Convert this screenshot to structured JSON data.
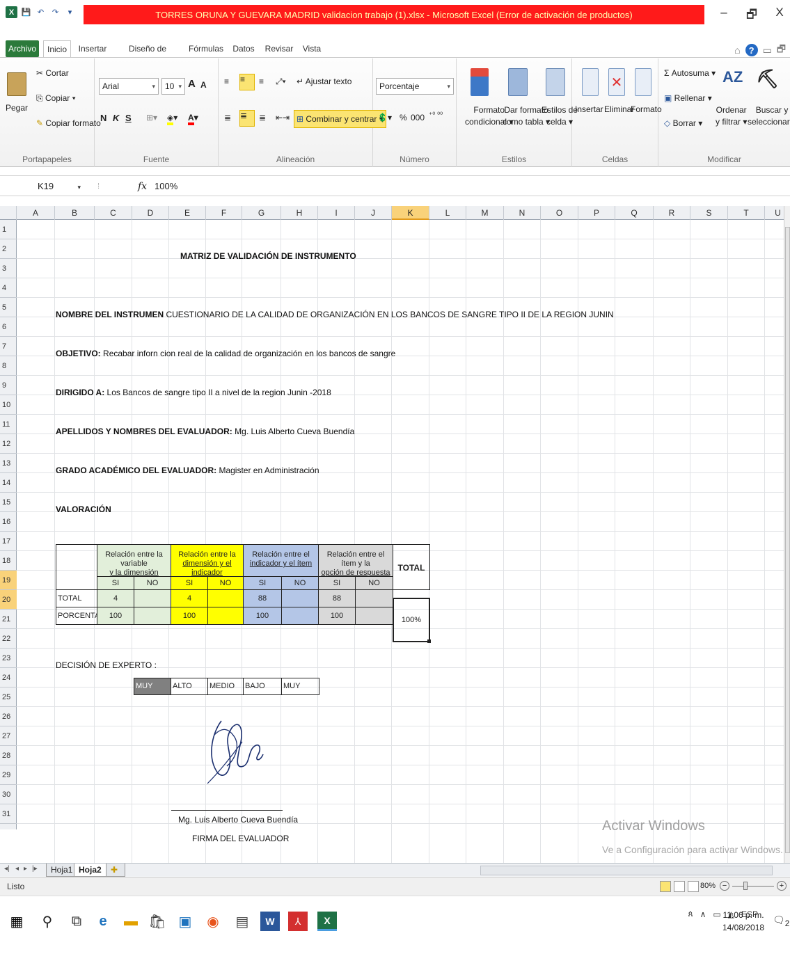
{
  "window": {
    "title": "TORRES ORUNA Y GUEVARA MADRID validacion trabajo (1).xlsx - Microsoft Excel (Error de activación de productos)",
    "minimize": "–",
    "restore": "🗗",
    "close": "X"
  },
  "tabs": [
    "Archivo",
    "Inicio",
    "Insertar",
    "Diseño de página",
    "Fórmulas",
    "Datos",
    "Revisar",
    "Vista"
  ],
  "ribbon": {
    "clipboard": {
      "paste": "Pegar",
      "cut": "Cortar",
      "copy": "Copiar ▾",
      "format_painter": "Copiar formato",
      "label": "Portapapeles"
    },
    "font": {
      "name": "Arial",
      "size": "10",
      "bold": "N",
      "italic": "K",
      "underline": "S",
      "grow": "A",
      "shrink": "A",
      "label": "Fuente"
    },
    "alignment": {
      "wrap": "Ajustar texto",
      "merge": "Combinar y centrar",
      "label": "Alineación"
    },
    "number": {
      "format": "Porcentaje",
      "percent": "%",
      "thousands": "000",
      "label": "Número"
    },
    "styles": {
      "conditional_1": "Formato",
      "conditional_2": "condicional ▾",
      "table_1": "Dar formato",
      "table_2": "como tabla ▾",
      "cell_1": "Estilos de",
      "cell_2": "celda ▾",
      "label": "Estilos"
    },
    "cells": {
      "insert": "Insertar",
      "delete": "Eliminar",
      "format": "Formato",
      "label": "Celdas"
    },
    "editing": {
      "autosum": "Σ Autosuma ▾",
      "fill": "Rellenar ▾",
      "clear": "Borrar ▾",
      "sort_1": "Ordenar",
      "sort_2": "y filtrar ▾",
      "find_1": "Buscar y",
      "find_2": "seleccionar ▾",
      "label": "Modificar"
    }
  },
  "formula_bar": {
    "name_box": "K19",
    "fx": "fx",
    "value": "100%"
  },
  "columns": [
    "A",
    "B",
    "C",
    "D",
    "E",
    "F",
    "G",
    "H",
    "I",
    "J",
    "K",
    "L",
    "M",
    "N",
    "O",
    "P",
    "Q",
    "R",
    "S",
    "T",
    "U"
  ],
  "selected_column": "K",
  "selected_rows": [
    "19",
    "20"
  ],
  "sheet": {
    "title": "MATRIZ DE VALIDACIÓN DE INSTRUMENTO",
    "r5_label": "NOMBRE DEL INSTRUMEN",
    "r5_value": "CUESTIONARIO DE LA CALIDAD DE ORGANIZACIÓN EN LOS BANCOS DE SANGRE TIPO II DE LA REGION JUNIN",
    "r7_label": "OBJETIVO:",
    "r7_value": " Recabar inforn cion real de la calidad de organización en los bancos de sangre",
    "r9_label": "DIRIGIDO A:",
    "r9_value": " Los Bancos de sangre tipo II a nivel  de la region Junin -2018",
    "r11_label": "APELLIDOS Y NOMBRES DEL EVALUADOR:",
    "r11_value": " Mg. Luis Alberto Cueva Buendía",
    "r13_label": "GRADO ACADÉMICO DEL EVALUADOR:",
    "r13_value": " Magister en Administración",
    "r15_label": "VALORACIÓN",
    "table": {
      "h1_a": "Relación entre la variable",
      "h1_b": "y la dimensión",
      "h2_a": "Relación entre la",
      "h2_b": "dimensión y el indicador",
      "h3_a": "Relación entre el",
      "h3_b": "indicador y el ítem",
      "h4_a": "Relación entre el ítem y la",
      "h4_b": "opción de respuesta",
      "total_header": "TOTAL",
      "si": "SI",
      "no": "NO",
      "row_total": "TOTAL",
      "row_pct": "PORCENTAJE",
      "total_values": [
        "4",
        "",
        "4",
        "",
        "88",
        "",
        "88",
        ""
      ],
      "pct_values": [
        "100",
        "",
        "100",
        "",
        "100",
        "",
        "100",
        ""
      ],
      "total_result": "100%"
    },
    "decision_label": "DECISIÓN DE EXPERTO :",
    "decision_options": [
      "MUY ALTO",
      "ALTO",
      "MEDIO",
      "BAJO",
      "MUY BAJO"
    ],
    "signature_name": "Mg. Luis Alberto Cueva Buendía",
    "signature_caption": "FIRMA DEL EVALUADOR"
  },
  "sheet_tabs": [
    "Hoja1",
    "Hoja2"
  ],
  "status": {
    "text": "Listo",
    "zoom": "80%"
  },
  "watermark": {
    "line1": "Activar Windows",
    "line2": "Ve a Configuración para activar Windows."
  },
  "taskbar": {
    "lang": "ESP",
    "time": "11:06 p. m.",
    "date": "14/08/2018",
    "notif": "2"
  }
}
